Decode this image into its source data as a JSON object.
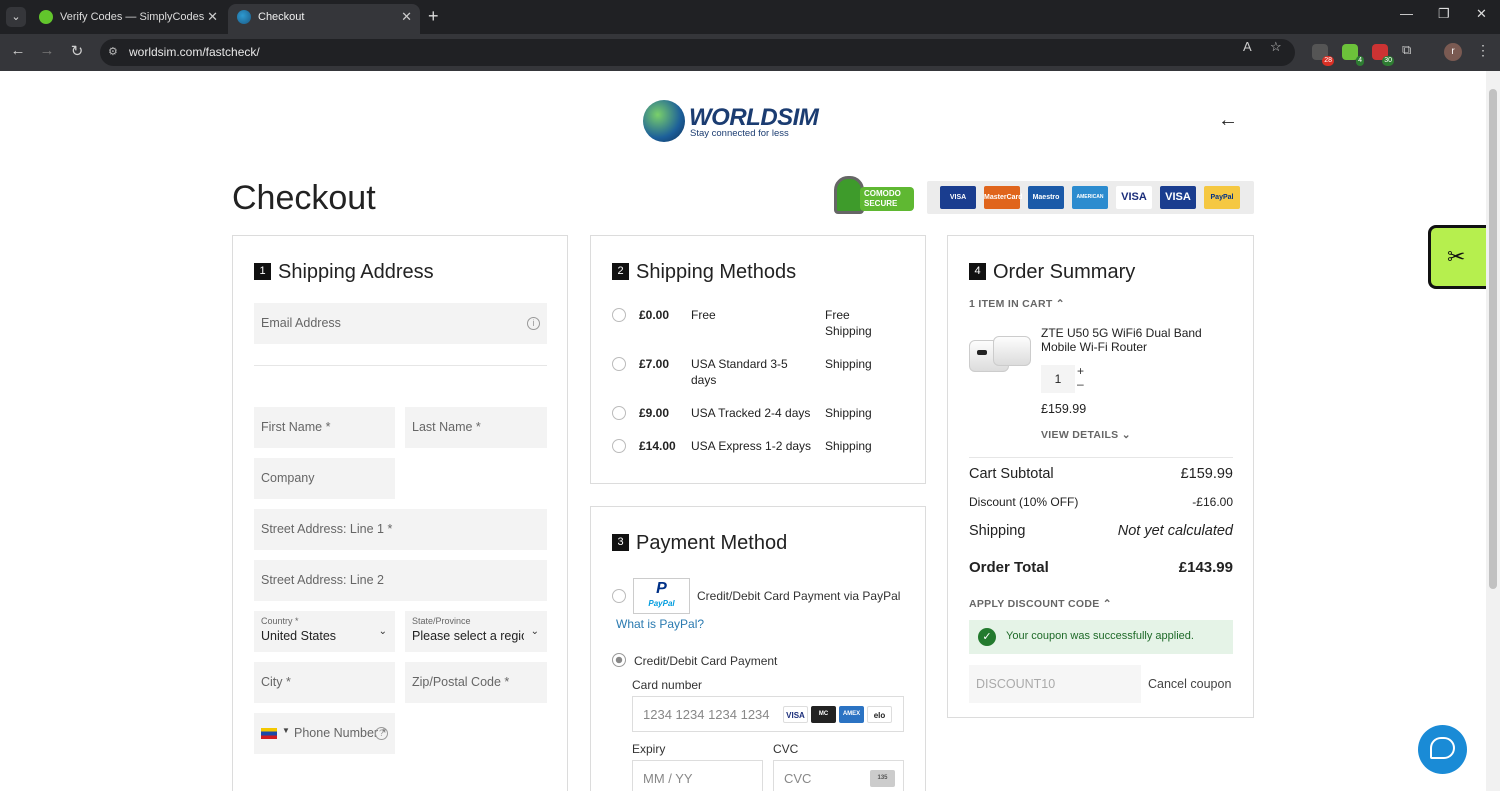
{
  "browser": {
    "tabs": [
      {
        "title": "Verify Codes — SimplyCodes",
        "active": false
      },
      {
        "title": "Checkout",
        "active": true
      }
    ],
    "url": "worldsim.com/fastcheck/",
    "extension_badges": [
      "28",
      "4",
      "30"
    ],
    "profile_initial": "r"
  },
  "header": {
    "logo_brand": "WORLDSIM",
    "logo_tagline": "Stay connected for less",
    "page_title": "Checkout",
    "secure_badge": "COMODO SECURE",
    "card_logos": [
      "VISA Electron",
      "MasterCard",
      "Maestro",
      "AMERICAN EXPRESS",
      "VISA",
      "VISA",
      "PayPal"
    ]
  },
  "shipping_address": {
    "step": "1",
    "title": "Shipping Address",
    "email_placeholder": "Email Address",
    "first_name_placeholder": "First Name *",
    "last_name_placeholder": "Last Name *",
    "company_placeholder": "Company",
    "street1_placeholder": "Street Address: Line 1 *",
    "street2_placeholder": "Street Address: Line 2",
    "country_label": "Country *",
    "country_value": "United States",
    "state_label": "State/Province",
    "state_value": "Please select a region",
    "city_placeholder": "City *",
    "zip_placeholder": "Zip/Postal Code *",
    "phone_placeholder": "Phone Number *"
  },
  "shipping_methods": {
    "step": "2",
    "title": "Shipping Methods",
    "options": [
      {
        "price": "£0.00",
        "name": "Free",
        "carrier": "Free Shipping"
      },
      {
        "price": "£7.00",
        "name": "USA Standard 3-5 days",
        "carrier": "Shipping"
      },
      {
        "price": "£9.00",
        "name": "USA Tracked 2-4 days",
        "carrier": "Shipping"
      },
      {
        "price": "£14.00",
        "name": "USA Express 1-2 days",
        "carrier": "Shipping"
      }
    ]
  },
  "payment": {
    "step": "3",
    "title": "Payment Method",
    "paypal_option": "Credit/Debit Card Payment via PayPal",
    "paypal_logo_top": "P",
    "paypal_logo_bottom": "PayPal",
    "what_is_paypal": "What is PayPal?",
    "card_option": "Credit/Debit Card Payment",
    "card_number_label": "Card number",
    "card_number_placeholder": "1234 1234 1234 1234",
    "card_brands": [
      "VISA",
      "MC",
      "AMEX",
      "elo"
    ],
    "expiry_label": "Expiry",
    "expiry_placeholder": "MM / YY",
    "cvc_label": "CVC",
    "cvc_placeholder": "CVC",
    "cvc_icon_text": "135"
  },
  "order_summary": {
    "step": "4",
    "title": "Order Summary",
    "items_in_cart": "1 ITEM IN CART",
    "product_name": "ZTE U50 5G WiFi6 Dual Band Mobile Wi-Fi Router",
    "quantity": "1",
    "price": "£159.99",
    "view_details": "VIEW DETAILS",
    "subtotal_label": "Cart Subtotal",
    "subtotal_value": "£159.99",
    "discount_label": "Discount (10% OFF)",
    "discount_value": "-£16.00",
    "shipping_label": "Shipping",
    "shipping_value": "Not yet calculated",
    "total_label": "Order Total",
    "total_value": "£143.99",
    "apply_discount": "APPLY DISCOUNT CODE",
    "coupon_message": "Your coupon was successfully applied.",
    "coupon_code": "DISCOUNT10",
    "cancel_coupon": "Cancel coupon"
  }
}
